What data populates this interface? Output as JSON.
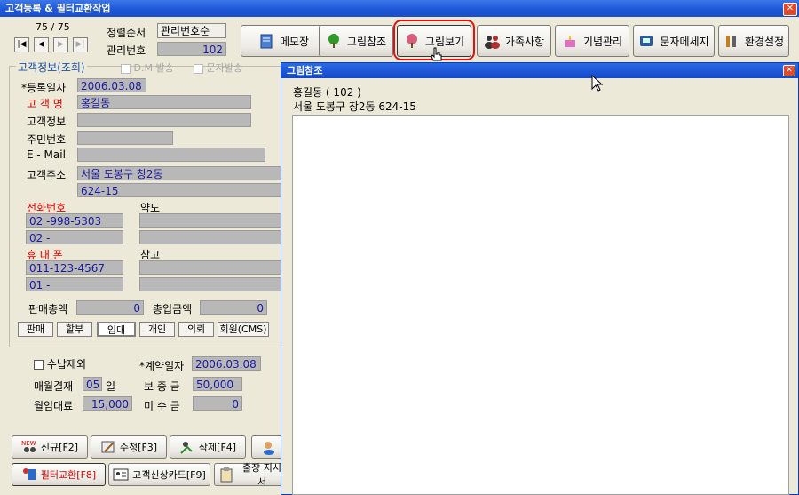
{
  "window": {
    "title": "고객등록 & 필터교환작업",
    "close": "✕"
  },
  "record_nav": {
    "counter": "75 / 75",
    "sort_label": "정렬순서",
    "sort_value": "관리번호순",
    "id_label": "관리번호",
    "id_value": "102"
  },
  "toolbar": [
    {
      "label": "메모장"
    },
    {
      "label": "그림참조"
    },
    {
      "label": "그림보기"
    },
    {
      "label": "가족사항"
    },
    {
      "label": "기념관리"
    },
    {
      "label": "문자메세지"
    },
    {
      "label": "환경설정"
    }
  ],
  "customer": {
    "group_label": "고객정보(조회)",
    "dm_label": "D.M 발송",
    "sms_label": "문자발송",
    "reg_date_label": "*등록일자",
    "reg_date": "2006.03.08",
    "name_label": "고 객 명",
    "name": "홍길동",
    "info_label": "고객정보",
    "ssn_label": "주민번호",
    "email_label": "E - Mail",
    "addr_label": "고객주소",
    "addr1": "서울 도봉구 창2동",
    "addr2": "624-15",
    "phone_label": "전화번호",
    "phone1": "02 -998-5303",
    "phone2": "02 -",
    "map_label": "약도",
    "mobile_label": "휴 대 폰",
    "mobile1": "011-123-4567",
    "mobile2": "01 -",
    "note_label": "참고",
    "sales_total_label": "판매총액",
    "sales_total": "0",
    "paid_total_label": "총입금액",
    "paid_total": "0"
  },
  "tabs": [
    "판매",
    "할부",
    "임대",
    "개인",
    "의뢰",
    "회원(CMS)"
  ],
  "rental": {
    "exclude_label": "수납제외",
    "contract_label": "*계약일자",
    "contract_date": "2006.03.08",
    "monthly_label": "매월결재",
    "monthly_day": "05",
    "day_unit": "일",
    "deposit_label": "보 증 금",
    "deposit": "50,000",
    "rent_label": "월임대료",
    "rent": "15,000",
    "unpaid_label": "미 수 금",
    "unpaid": "0"
  },
  "bottom_buttons": {
    "new": "신규[F2]",
    "edit": "수정[F3]",
    "delete": "삭제[F4]",
    "filter": "필터교환[F8]",
    "card": "고객신상카드[F9]",
    "visit": "출장 지시서"
  },
  "popup": {
    "title": "그림참조",
    "line1": "홍길동 ( 102 )",
    "line2": "서울 도봉구 창2동 624-15",
    "close": "✕"
  },
  "colors": {
    "title_blue": "#1c55d6",
    "highlight_ring": "#e01010",
    "field_text": "#1a1aa0"
  }
}
